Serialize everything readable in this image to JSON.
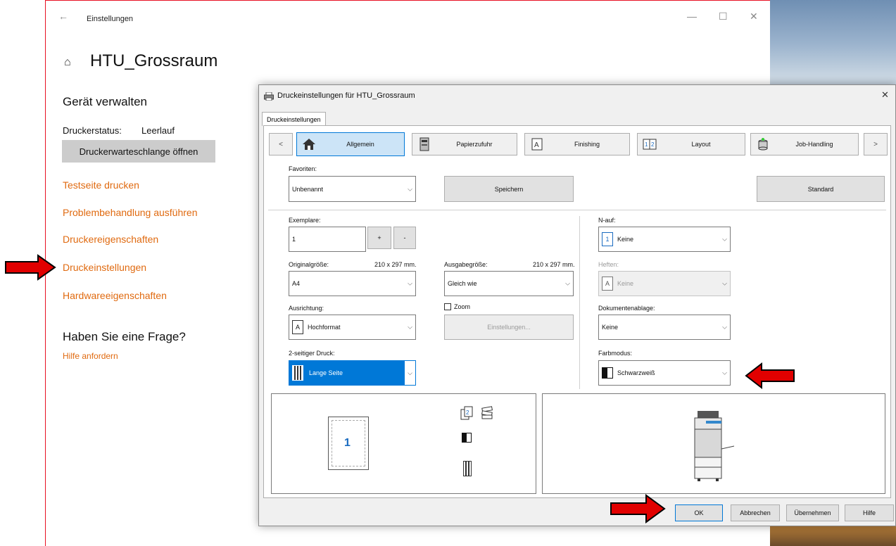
{
  "settings": {
    "window_title": "Einstellungen",
    "page_title": "HTU_Grossraum",
    "section_heading": "Gerät verwalten",
    "status_label": "Druckerstatus:",
    "status_value": "Leerlauf",
    "queue_button": "Druckerwarteschlange öffnen",
    "links": [
      "Testseite drucken",
      "Problembehandlung ausführen",
      "Druckereigenschaften",
      "Druckeinstellungen",
      "Hardwareeigenschaften"
    ],
    "question_heading": "Haben Sie eine Frage?",
    "help_link": "Hilfe anfordern"
  },
  "dialog": {
    "title": "Druckeinstellungen für HTU_Grossraum",
    "tab": "Druckeinstellungen",
    "nav_prev": "<",
    "nav_next": ">",
    "nav_items": [
      "Allgemein",
      "Papierzufuhr",
      "Finishing",
      "Layout",
      "Job-Handling"
    ],
    "favorites_label": "Favoriten:",
    "favorites_value": "Unbenannt",
    "save_button": "Speichern",
    "default_button": "Standard",
    "copies_label": "Exemplare:",
    "copies_value": "1",
    "plus": "+",
    "minus": "-",
    "original_size_label": "Originalgröße:",
    "original_size_dims": "210 x 297 mm.",
    "original_size_value": "A4",
    "output_size_label": "Ausgabegröße:",
    "output_size_dims": "210 x 297 mm.",
    "output_size_value": "Gleich wie",
    "orientation_label": "Ausrichtung:",
    "orientation_value": "Hochformat",
    "zoom_label": "Zoom",
    "zoom_settings_button": "Einstellungen...",
    "duplex_label": "2-seitiger Druck:",
    "duplex_value": "Lange Seite",
    "nup_label": "N-auf:",
    "nup_icon_text": "1",
    "nup_value": "Keine",
    "staple_label": "Heften:",
    "staple_value": "Keine",
    "doc_filing_label": "Dokumentenablage:",
    "doc_filing_value": "Keine",
    "color_mode_label": "Farbmodus:",
    "color_mode_value": "Schwarzweiß",
    "preview_page_number": "1",
    "buttons": {
      "ok": "OK",
      "cancel": "Abbrechen",
      "apply": "Übernehmen",
      "help": "Hilfe"
    }
  },
  "colors": {
    "accent_orange": "#e06a10",
    "selection_blue": "#0078d7",
    "annotation_red": "#e10000"
  }
}
